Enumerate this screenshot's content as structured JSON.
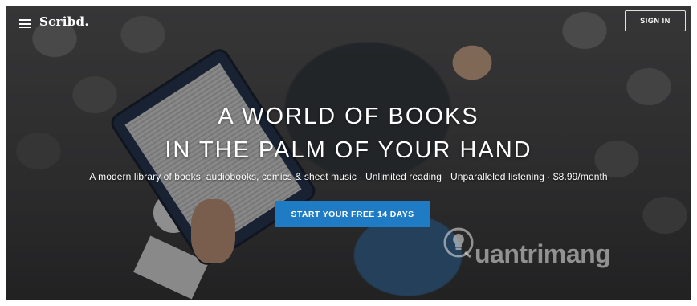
{
  "header": {
    "logo": "Scribd.",
    "signin_label": "SIGN IN"
  },
  "hero": {
    "headline_line1": "A WORLD OF BOOKS",
    "headline_line2": "IN THE PALM OF YOUR HAND",
    "subtitle": "A modern library of books, audiobooks, comics & sheet music · Unlimited reading · Unparalleled listening · $8.99/month",
    "cta_label": "START YOUR FREE 14 DAYS"
  },
  "watermark": {
    "text": "uantrimang"
  },
  "colors": {
    "cta": "#1e7bc4",
    "text": "#ffffff"
  }
}
